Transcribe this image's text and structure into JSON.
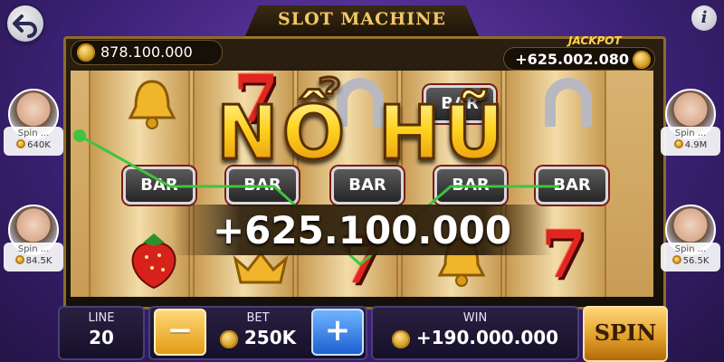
{
  "header": {
    "title": "SLOT MACHINE"
  },
  "balance": {
    "amount": "878.100.000"
  },
  "jackpot": {
    "label": "JACKPOT",
    "amount": "+625.002.080"
  },
  "big_win": {
    "text": "NỔ HŨ",
    "amount": "+625.100.000"
  },
  "reels": {
    "row1": [
      "bell",
      "7",
      "horseshoe",
      "BAR",
      "horseshoe"
    ],
    "row2": [
      "BAR",
      "BAR",
      "BAR",
      "BAR",
      "BAR"
    ],
    "row3": [
      "strawberry",
      "crown",
      "7",
      "bell",
      "7"
    ],
    "bar_label": "BAR",
    "seven_label": "7",
    "payline_color": "#3ec43e"
  },
  "players": [
    {
      "name": "Spin ...",
      "balance": "640K"
    },
    {
      "name": "Spin ...",
      "balance": "84.5K"
    },
    {
      "name": "Spin ...",
      "balance": "4.9M"
    },
    {
      "name": "Spin ...",
      "balance": "56.5K"
    }
  ],
  "controls": {
    "line_label": "LINE",
    "line_value": "20",
    "bet_label": "BET",
    "bet_value": "250K",
    "minus_label": "−",
    "plus_label": "+",
    "win_label": "WIN",
    "win_value": "+190.000.000",
    "spin_label": "SPIN"
  },
  "icons": {
    "back": "back-arrow-icon",
    "info": "info-icon",
    "coin": "coin-icon"
  }
}
